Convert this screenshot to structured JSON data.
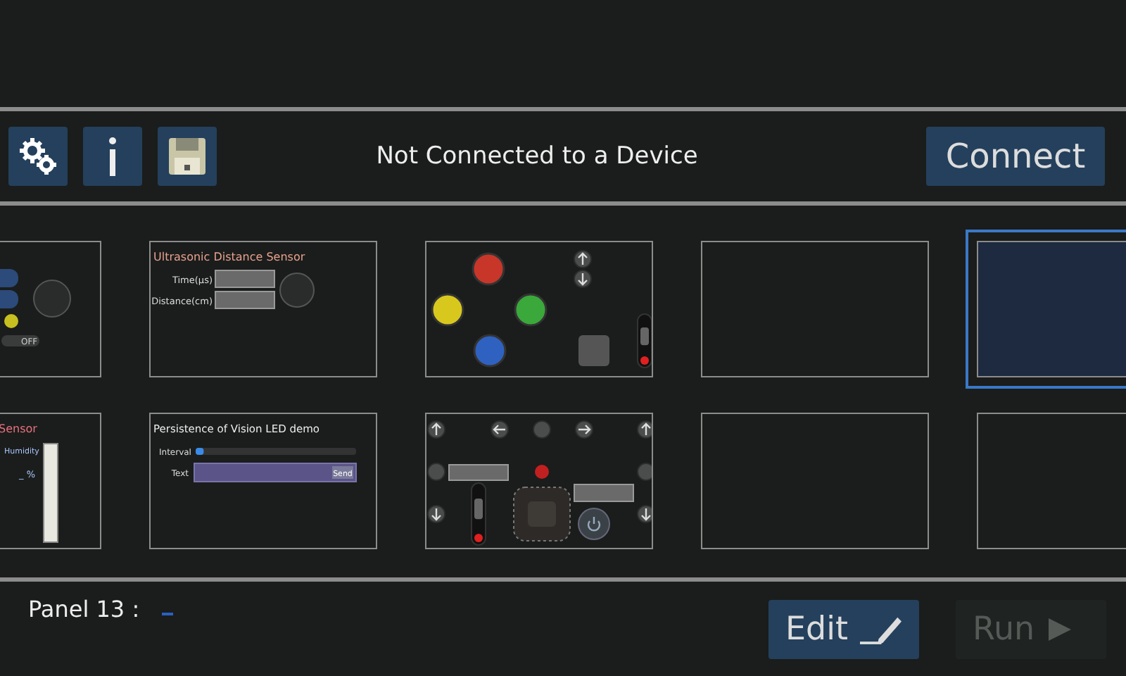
{
  "status": "Not Connected to a Device",
  "connect_button": "Connect",
  "panels": [
    {
      "kind": "controls",
      "selected": false,
      "toggle_label": "OFF"
    },
    {
      "kind": "ultrasonic",
      "selected": false,
      "title": "Ultrasonic Distance Sensor",
      "fields": [
        "Time(µs)",
        "Distance(cm)"
      ]
    },
    {
      "kind": "arcade",
      "selected": false,
      "buttons": [
        {
          "color": "#c8362a"
        },
        {
          "color": "#d8c81e"
        },
        {
          "color": "#3aa83a"
        },
        {
          "color": "#2f62c0"
        }
      ]
    },
    {
      "kind": "empty",
      "selected": false
    },
    {
      "kind": "empty",
      "selected": true
    },
    {
      "kind": "humidity",
      "selected": false,
      "title": "Sensor",
      "label": "Humidity",
      "reading": "_ %"
    },
    {
      "kind": "pov",
      "selected": false,
      "title": "Persistence of Vision LED demo",
      "slider_label": "Interval",
      "level": 0.05,
      "text_label": "Text",
      "send_button": "Send"
    },
    {
      "kind": "gamepad",
      "selected": false
    },
    {
      "kind": "empty",
      "selected": false
    },
    {
      "kind": "empty",
      "selected": false
    }
  ],
  "footer": {
    "panel_label": "Panel 13 :",
    "edit_button": "Edit",
    "run_button": {
      "label": "Run",
      "disabled": true
    }
  }
}
